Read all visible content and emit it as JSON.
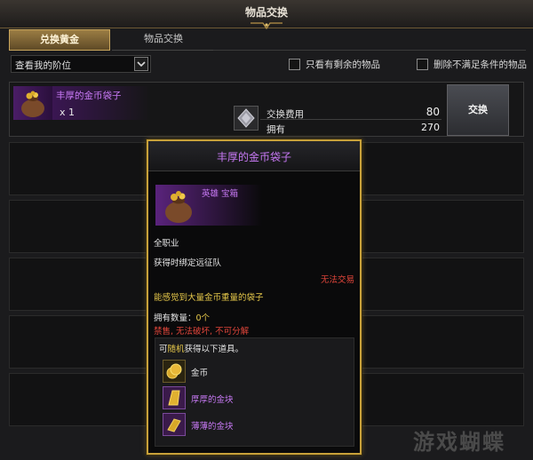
{
  "window": {
    "title": "物品交换"
  },
  "tabs": [
    {
      "label": "兑换黄金",
      "active": true
    },
    {
      "label": "物品交换",
      "active": false
    }
  ],
  "filter": {
    "select_value": "查看我的阶位",
    "checkbox_1": {
      "label": "只看有剩余的物品",
      "checked": false
    },
    "checkbox_2": {
      "label": "删除不满足条件的物品",
      "checked": false
    }
  },
  "list": {
    "rows": [
      {
        "item_name": "丰厚的金币袋子",
        "quantity": "x 1",
        "cost_label": "交换费用",
        "cost_value": "80",
        "owned_label": "拥有",
        "owned_value": "270",
        "button_label": "交换"
      }
    ]
  },
  "tooltip": {
    "title": "丰厚的金币袋子",
    "item_type": "英雄 宝箱",
    "class": "全职业",
    "bind": "获得时绑定远征队",
    "trade": "无法交易",
    "description": "能感觉到大量金币重量的袋子",
    "owned_count_label": "拥有数量：",
    "owned_count_value": "0个",
    "restrictions": "禁售, 无法破坏, 不可分解",
    "rewards_prefix": "可",
    "rewards_highlight": "随机",
    "rewards_suffix": "获得以下道具。",
    "rewards": [
      {
        "name": "金币",
        "color": "#e6e6e6",
        "icon": "gold-coin-icon"
      },
      {
        "name": "厚厚的金块",
        "color": "#c879f5",
        "icon": "gold-bar-icon"
      },
      {
        "name": "薄薄的金块",
        "color": "#c879f5",
        "icon": "gold-bar-icon"
      }
    ]
  },
  "watermark": {
    "text": "游戏蝴蝶"
  },
  "colors": {
    "accent_gold": "#c8a13a",
    "hero_purple": "#c879f5",
    "warning_red": "#e0453a",
    "highlight_yellow": "#e6c84a"
  }
}
